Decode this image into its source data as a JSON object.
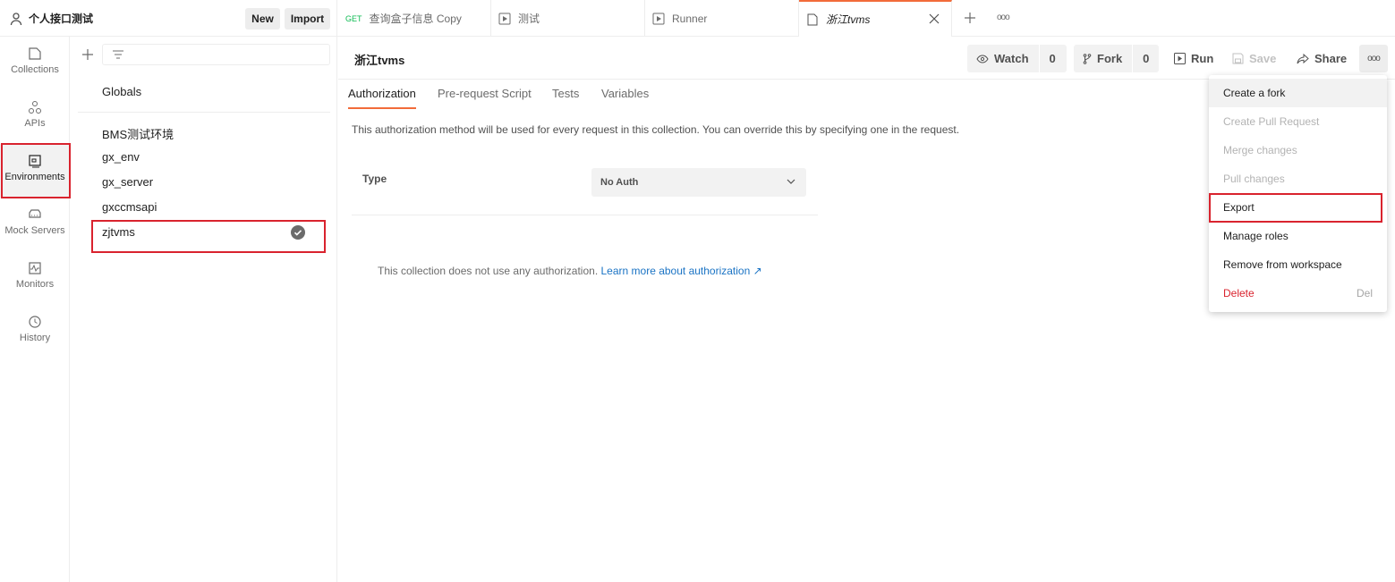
{
  "workspace": {
    "name": "个人接口测试",
    "new_label": "New",
    "import_label": "Import"
  },
  "tabs": [
    {
      "method": "GET",
      "label": "查询盒子信息 Copy"
    },
    {
      "label": "测试"
    },
    {
      "label": "Runner"
    },
    {
      "label": "浙江tvms",
      "active": true
    }
  ],
  "tab_more_label": "ooo",
  "rail": [
    {
      "label": "Collections",
      "icon": "collections-icon"
    },
    {
      "label": "APIs",
      "icon": "apis-icon"
    },
    {
      "label": "Environments",
      "icon": "environments-icon",
      "active": true
    },
    {
      "label": "Mock Servers",
      "icon": "mock-servers-icon"
    },
    {
      "label": "Monitors",
      "icon": "monitors-icon"
    },
    {
      "label": "History",
      "icon": "history-icon"
    }
  ],
  "env_panel": {
    "filter_placeholder": "",
    "globals_label": "Globals",
    "environments": [
      "BMS测试环境",
      "gx_env",
      "gx_server",
      "gxccmsapi",
      "zjtvms"
    ],
    "active_environment": "zjtvms"
  },
  "collection": {
    "title": "浙江tvms",
    "watch_label": "Watch",
    "watch_count": "0",
    "fork_label": "Fork",
    "fork_count": "0",
    "run_label": "Run",
    "save_label": "Save",
    "share_label": "Share",
    "more_label": "ooo"
  },
  "subtabs": [
    "Authorization",
    "Pre-request Script",
    "Tests",
    "Variables"
  ],
  "active_subtab": "Authorization",
  "auth": {
    "description": "This authorization method will be used for every request in this collection. You can override this by specifying one in the request.",
    "type_label": "Type",
    "type_value": "No Auth",
    "no_auth_text": "This collection does not use any authorization.",
    "learn_more": "Learn more about authorization ↗"
  },
  "menu": [
    {
      "label": "Create a fork",
      "state": "hover"
    },
    {
      "label": "Create Pull Request",
      "state": "disabled"
    },
    {
      "label": "Merge changes",
      "state": "disabled"
    },
    {
      "label": "Pull changes",
      "state": "disabled"
    },
    {
      "label": "Export",
      "state": "highlighted"
    },
    {
      "label": "Manage roles",
      "state": "normal"
    },
    {
      "label": "Remove from workspace",
      "state": "normal"
    },
    {
      "label": "Delete",
      "state": "danger",
      "shortcut": "Del"
    }
  ],
  "colors": {
    "accent": "#f26b3a",
    "highlight_box": "#d9232e",
    "link": "#1a73c4",
    "get_method": "#0cbb52"
  }
}
